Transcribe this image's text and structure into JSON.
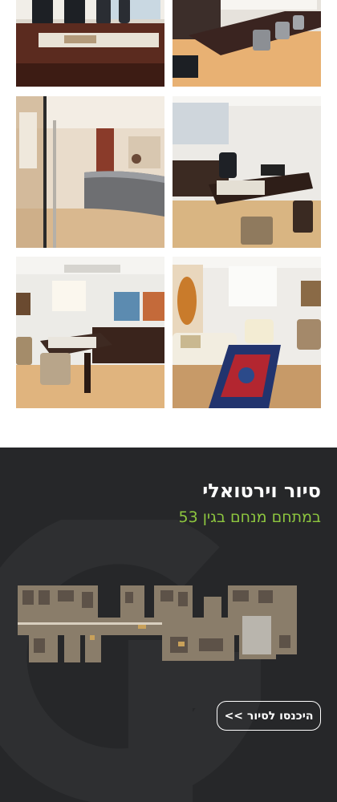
{
  "gallery": {
    "photos": [
      {
        "subject": "conference-room-photo"
      },
      {
        "subject": "boardroom-photo"
      },
      {
        "subject": "reception-lobby-photo"
      },
      {
        "subject": "manager-office-photo"
      },
      {
        "subject": "executive-office-photo"
      },
      {
        "subject": "lounge-office-photo"
      }
    ]
  },
  "virtual_tour": {
    "title": "סיור וירטואלי",
    "subtitle": "במתחם מנחם בגין 53",
    "enter_button": "היכנסו לסיור >>",
    "colors": {
      "background": "#262729",
      "subtitle": "#8dc63f",
      "text": "#ffffff"
    },
    "icons": [
      "logo-watermark-icon",
      "floorplan-image"
    ]
  }
}
